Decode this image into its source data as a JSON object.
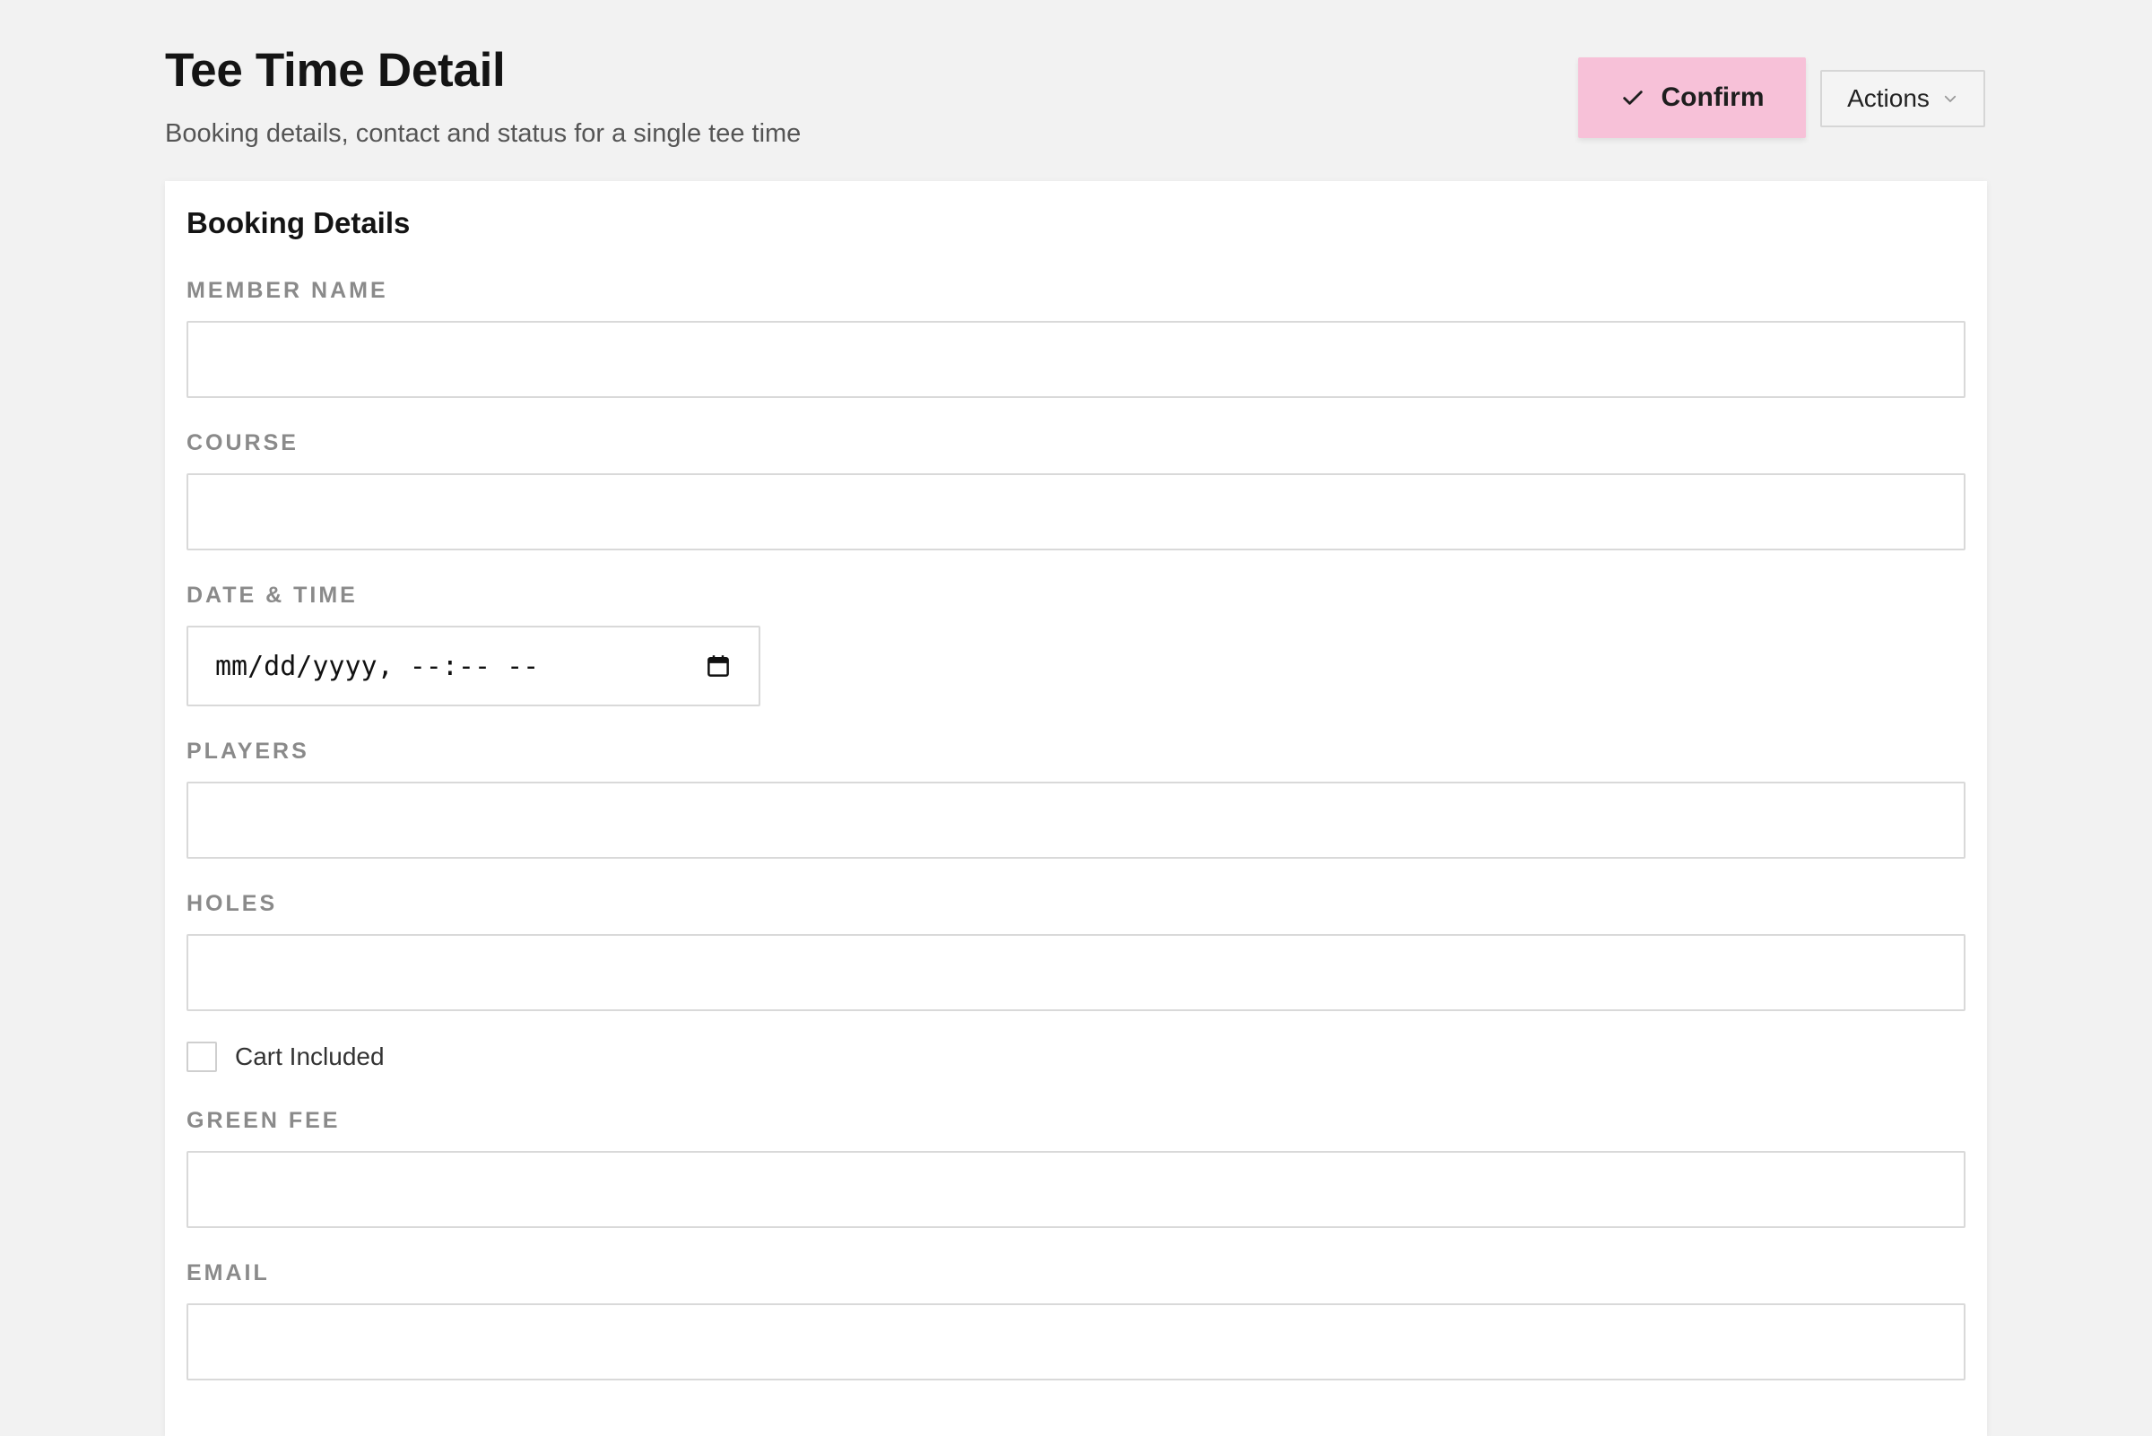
{
  "header": {
    "title": "Tee Time Detail",
    "subtitle": "Booking details, contact and status for a single tee time",
    "confirm_label": "Confirm",
    "actions_label": "Actions"
  },
  "card": {
    "title": "Booking Details",
    "fields": {
      "member_name": {
        "label": "MEMBER NAME",
        "value": ""
      },
      "course": {
        "label": "COURSE",
        "value": ""
      },
      "date_time": {
        "label": "DATE & TIME",
        "value": "mm/dd/yyyy, --:-- --"
      },
      "players": {
        "label": "PLAYERS",
        "value": ""
      },
      "holes": {
        "label": "HOLES",
        "value": ""
      },
      "green_fee": {
        "label": "GREEN FEE",
        "value": ""
      },
      "email": {
        "label": "EMAIL",
        "value": ""
      }
    },
    "cart_included": {
      "label": "Cart Included",
      "checked": false
    }
  },
  "icons": {
    "confirm": "check-icon",
    "actions": "chevron-down-icon",
    "date": "calendar-icon"
  },
  "colors": {
    "page_background": "#f2f2f2",
    "confirm_button": "#f7c1d8",
    "card_background": "#ffffff",
    "label_text": "#8a8a8a"
  }
}
